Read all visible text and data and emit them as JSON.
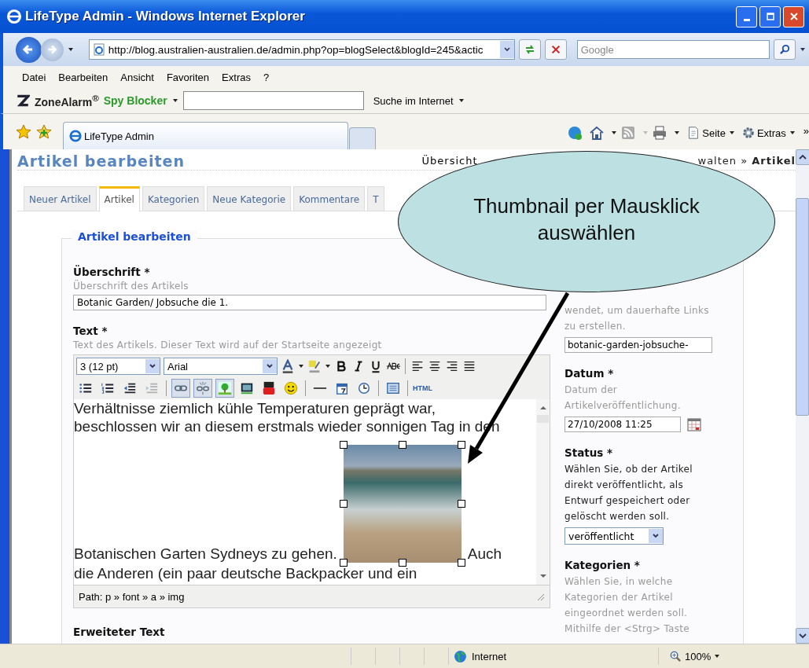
{
  "window": {
    "title": "LifeType Admin - Windows Internet Explorer"
  },
  "address_bar": {
    "url": "http://blog.australien-australien.de/admin.php?op=blogSelect&blogId=245&actic"
  },
  "search": {
    "placeholder": "Google"
  },
  "menu": [
    "Datei",
    "Bearbeiten",
    "Ansicht",
    "Favoriten",
    "Extras",
    "?"
  ],
  "zonealarm": {
    "brand": "ZoneAlarm$^{®}$",
    "product": "Spy Blocker",
    "search_label": "Suche im Internet"
  },
  "browser_tabs": [
    {
      "label": "LifeType Admin",
      "selected": true
    }
  ],
  "command_bar": {
    "page_label": "Seite",
    "tools_label": "Extras",
    "more": "»"
  },
  "page": {
    "heading": "Artikel bearbeiten",
    "breadcrumb_start": "Übersicht",
    "breadcrumb_end": "walten » **Artikel**",
    "tabs": [
      {
        "label": "Neuer Artikel",
        "selected": false
      },
      {
        "label": "Artikel",
        "selected": true
      },
      {
        "label": "Kategorien",
        "selected": false
      },
      {
        "label": "Neue Kategorie",
        "selected": false
      },
      {
        "label": "Kommentare",
        "selected": false
      },
      {
        "label": "T",
        "selected": false
      }
    ],
    "legend": "Artikel bearbeiten",
    "title_field": {
      "label": "Überschrift *",
      "hint": "Überschrift des Artikels",
      "value": "Botanic Garden/ Jobsuche die 1."
    },
    "text_field": {
      "label": "Text *",
      "hint": "Text des Artikels. Dieser Text wird auf der Startseite angezeigt"
    },
    "editor": {
      "font_size": "3 (12 pt)",
      "font_name": "Arial",
      "html_button": "HTML",
      "toolbar_row2": [
        [
          {
            "kind": "bullets",
            "active": false,
            "disabled": false
          },
          {
            "kind": "numbered",
            "active": false,
            "disabled": false
          },
          {
            "kind": "outdent",
            "active": false,
            "disabled": false
          },
          {
            "kind": "indent",
            "active": false,
            "disabled": true
          }
        ],
        [
          {
            "kind": "link",
            "active": true,
            "disabled": false
          },
          {
            "kind": "unlink",
            "active": true,
            "disabled": false
          },
          {
            "kind": "image",
            "active": true,
            "disabled": false
          },
          {
            "kind": "media",
            "active": false,
            "disabled": false
          },
          {
            "kind": "video",
            "active": false,
            "disabled": false
          },
          {
            "kind": "emoji",
            "active": false,
            "disabled": false
          }
        ],
        [
          {
            "kind": "rule",
            "active": false,
            "disabled": false
          },
          {
            "kind": "date",
            "active": false,
            "disabled": false
          },
          {
            "kind": "time",
            "active": false,
            "disabled": false
          }
        ],
        [
          {
            "kind": "template",
            "active": false,
            "disabled": false
          }
        ]
      ],
      "lines_before": [
        "Verhältnisse ziemlich kühle Temperaturen geprägt war,",
        "beschlossen wir an diesem erstmals wieder sonnigen Tag in den"
      ],
      "line_with_image_start": "Botanischen Garten Sydneys zu gehen.",
      "line_with_image_end": "Auch",
      "lines_after": [
        "die Anderen (ein paar deutsche Backpacker und ein"
      ],
      "image_selected": true,
      "path": "Path: p » font » a » img"
    },
    "extended_label": "Erweiteter Text",
    "slug": {
      "hint": "wendet, um dauerhafte Links zu erstellen.",
      "value": "botanic-garden-jobsuche-"
    },
    "date": {
      "label": "Datum *",
      "hint": "Datum der Artikelveröffentlichung.",
      "value": "27/10/2008 11:25"
    },
    "status": {
      "label": "Status *",
      "hint": "Wählen Sie, ob der Artikel direkt veröffentlicht, als Entwurf gespeichert oder gelöscht werden soll.",
      "value": "veröffentlicht"
    },
    "categories": {
      "label": "Kategorien *",
      "hint": "Wählen Sie, in welche Kategorien der Artikel eingeordnet werden soll. Mithilfe der <Strg> Taste"
    }
  },
  "callout": {
    "text": "Thumbnail per Mausklick auswählen"
  },
  "status_bar": {
    "zone": "Internet",
    "zoom": "100%"
  }
}
